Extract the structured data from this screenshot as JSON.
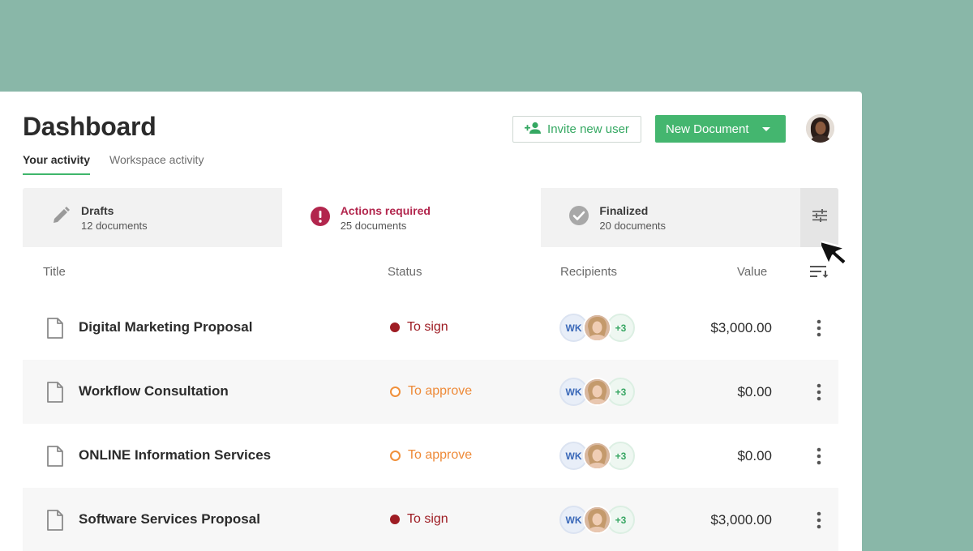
{
  "header": {
    "title": "Dashboard",
    "tabs": [
      {
        "label": "Your activity",
        "active": true
      },
      {
        "label": "Workspace activity",
        "active": false
      }
    ],
    "invite_label": "Invite new user",
    "new_document_label": "New Document"
  },
  "cards": [
    {
      "label": "Drafts",
      "sub": "12 documents",
      "icon": "pencil-icon"
    },
    {
      "label": "Actions required",
      "sub": "25 documents",
      "icon": "alert-icon",
      "active": true
    },
    {
      "label": "Finalized",
      "sub": "20 documents",
      "icon": "check-circle-icon"
    }
  ],
  "table": {
    "columns": {
      "title": "Title",
      "status": "Status",
      "recipients": "Recipients",
      "value": "Value"
    },
    "rows": [
      {
        "title": "Digital Marketing Proposal",
        "status": "To sign",
        "recipient_initials": "WK",
        "recipient_more": "+3",
        "value": "$3,000.00"
      },
      {
        "title": "Workflow Consultation",
        "status": "To approve",
        "recipient_initials": "WK",
        "recipient_more": "+3",
        "value": "$0.00"
      },
      {
        "title": "ONLINE Information Services",
        "status": "To approve",
        "recipient_initials": "WK",
        "recipient_more": "+3",
        "value": "$0.00"
      },
      {
        "title": "Software Services Proposal",
        "status": "To sign",
        "recipient_initials": "WK",
        "recipient_more": "+3",
        "value": "$3,000.00"
      }
    ]
  },
  "colors": {
    "background": "#89b7a8",
    "accent_green": "#44b66f",
    "action_red": "#b2264d",
    "status_sign": "#9e1c23",
    "status_approve": "#ee8a38"
  }
}
